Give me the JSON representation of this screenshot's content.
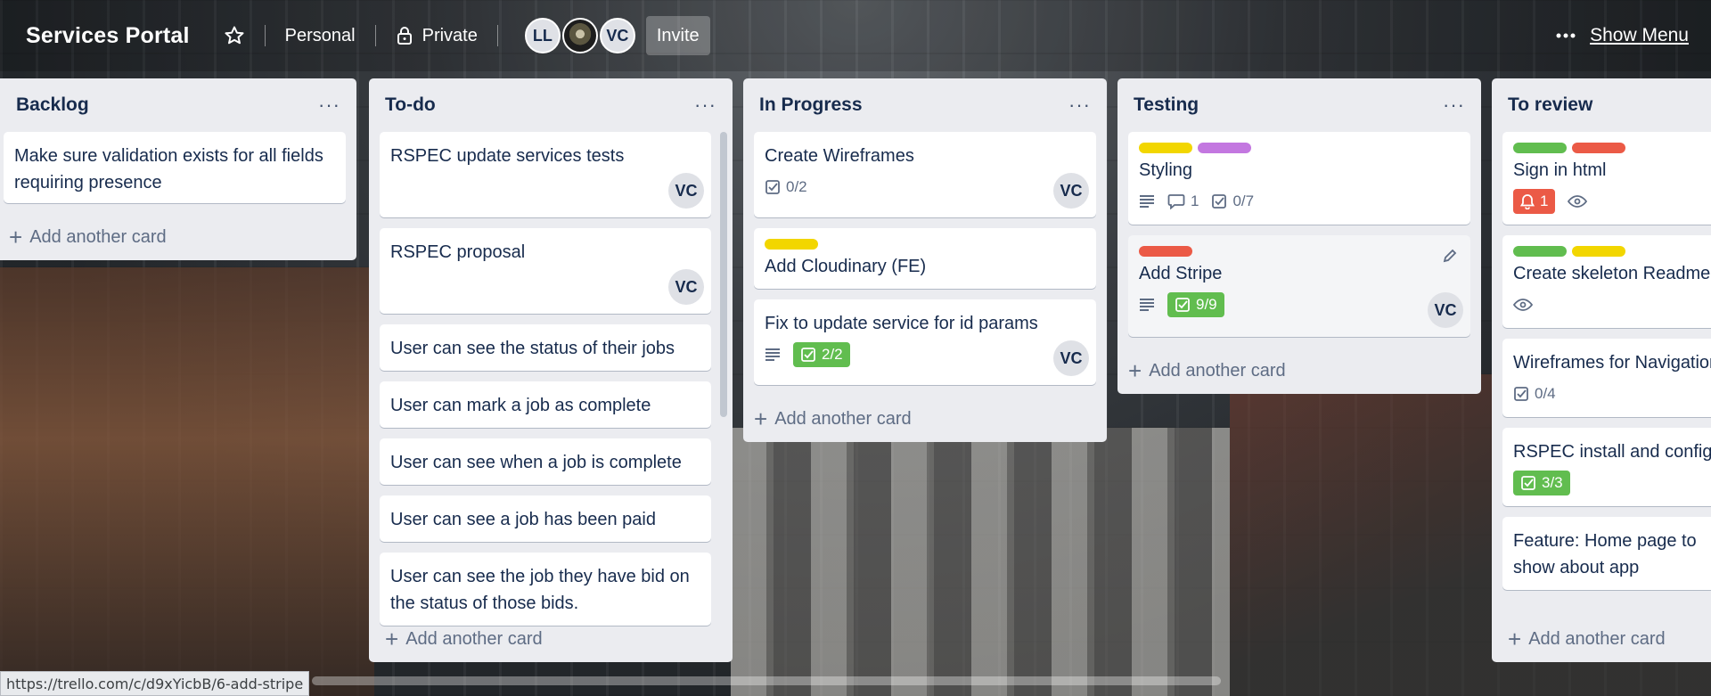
{
  "board": {
    "title": "Services Portal",
    "visibility_team": "Personal",
    "visibility_privacy": "Private",
    "members": [
      "LL",
      "VC"
    ],
    "invite_label": "Invite",
    "show_menu_label": "Show Menu"
  },
  "lists": [
    {
      "title": "Backlog",
      "cards": [
        {
          "title": "Make sure validation exists for all fields requiring presence"
        }
      ],
      "add_label": "Add another card"
    },
    {
      "title": "To-do",
      "cards": [
        {
          "title": "RSPEC update services tests",
          "member": "VC"
        },
        {
          "title": "RSPEC proposal",
          "member": "VC"
        },
        {
          "title": "User can see the status of their jobs"
        },
        {
          "title": "User can mark a job as complete"
        },
        {
          "title": "User can see when a job is complete"
        },
        {
          "title": "User can see a job has been paid"
        },
        {
          "title": "User can see the job they have bid on the status of those bids."
        }
      ],
      "add_label": "Add another card"
    },
    {
      "title": "In Progress",
      "cards": [
        {
          "title": "Create Wireframes",
          "checklist": "0/2",
          "member": "VC"
        },
        {
          "title": "Add Cloudinary (FE)",
          "labels": [
            "#f2d600"
          ]
        },
        {
          "title": "Fix to update service for id params",
          "checklist": "2/2",
          "member": "VC"
        }
      ],
      "add_label": "Add another card"
    },
    {
      "title": "Testing",
      "cards": [
        {
          "title": "Styling",
          "labels": [
            "#f2d600",
            "#c377e0"
          ],
          "comments": "1",
          "checklist": "0/7"
        },
        {
          "title": "Add Stripe",
          "labels": [
            "#eb5a46"
          ],
          "checklist": "9/9",
          "member": "VC"
        }
      ],
      "add_label": "Add another card"
    },
    {
      "title": "To review",
      "cards": [
        {
          "title": "Sign in html",
          "labels": [
            "#61bd4f",
            "#eb5a46"
          ],
          "notifications": "1"
        },
        {
          "title": "Create skeleton Readme",
          "labels": [
            "#61bd4f",
            "#f2d600"
          ]
        },
        {
          "title": "Wireframes for Navigation",
          "checklist": "0/4"
        },
        {
          "title": "RSPEC install and config",
          "checklist": "3/3"
        },
        {
          "title": "Feature: Home page to show about app"
        }
      ],
      "add_label": "Add another card"
    }
  ],
  "status_url": "https://trello.com/c/d9xYicbB/6-add-stripe",
  "colors": {
    "list_bg": "#ebecf0",
    "green": "#61bd4f",
    "red": "#eb5a46",
    "yellow": "#f2d600",
    "purple": "#c377e0"
  }
}
